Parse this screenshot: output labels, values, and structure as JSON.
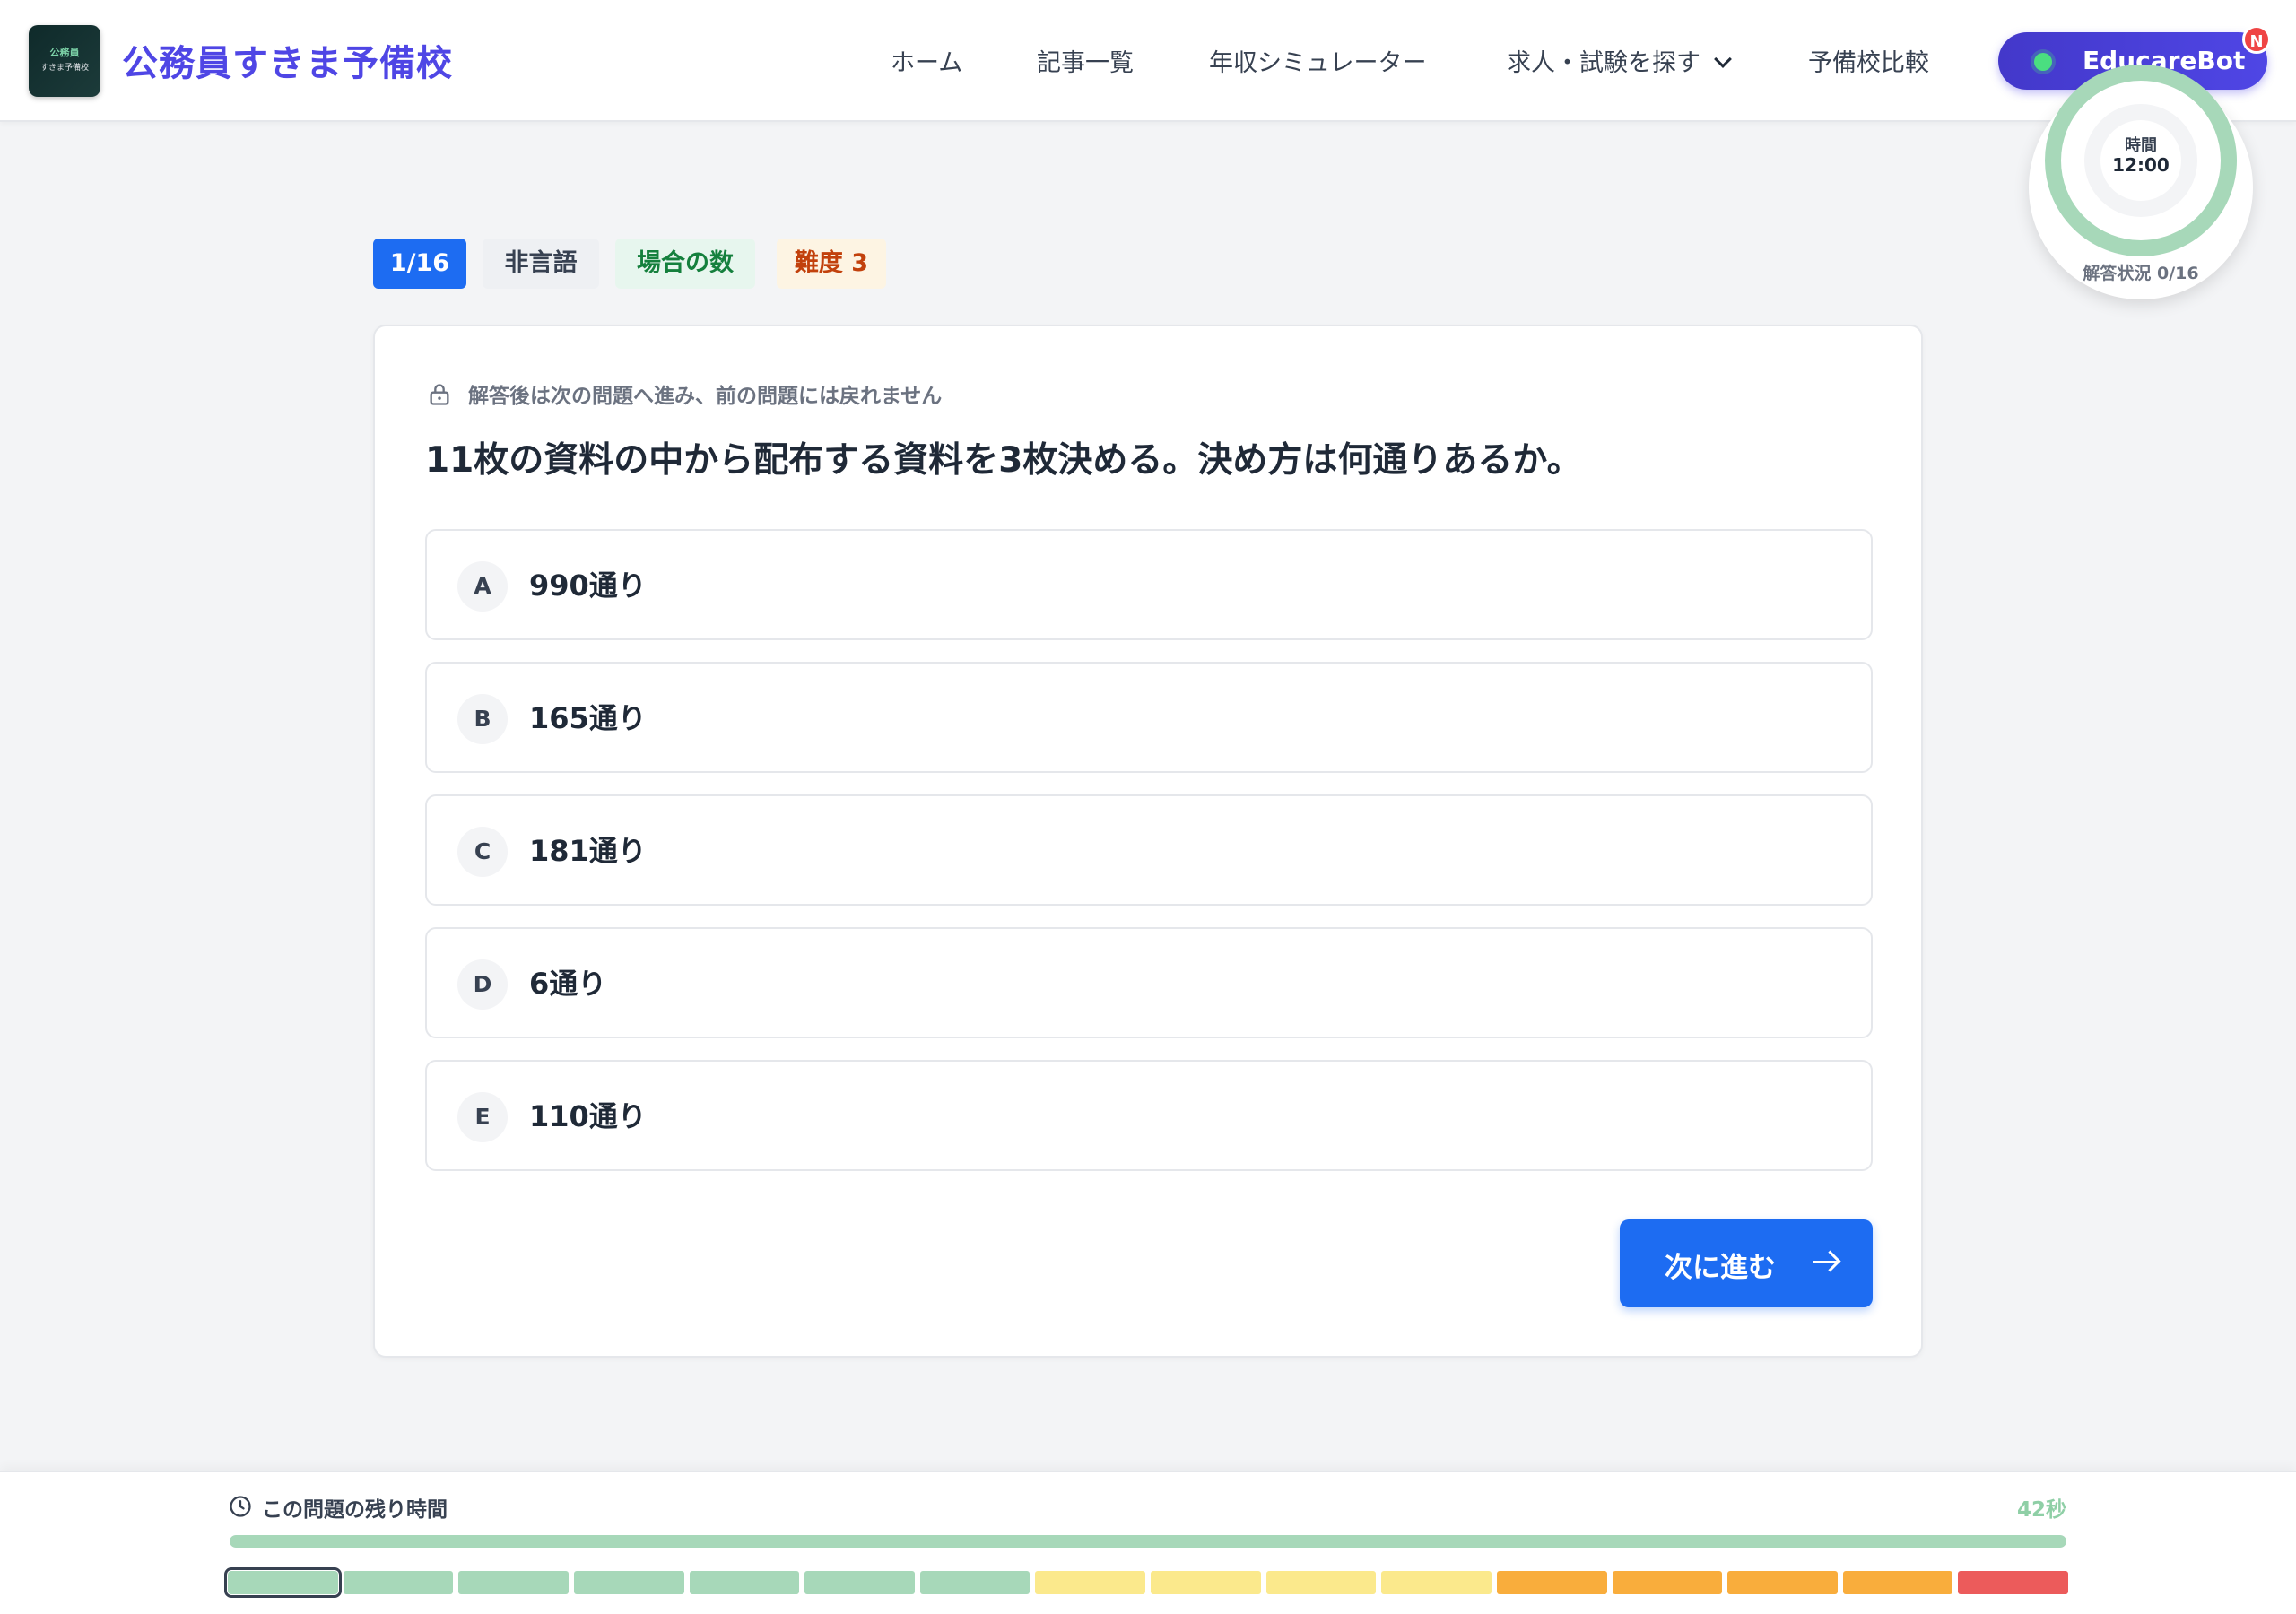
{
  "header": {
    "logo_line1": "公務員",
    "logo_line2": "すきま予備校",
    "brand": "公務員すきま予備校",
    "nav": [
      {
        "label": "ホーム"
      },
      {
        "label": "記事一覧"
      },
      {
        "label": "年収シミュレーター"
      },
      {
        "label": "求人・試験を探す"
      },
      {
        "label": "予備校比較"
      }
    ],
    "bot_label": "EducareBot",
    "bot_badge": "N"
  },
  "timer": {
    "label": "時間",
    "value": "12:00",
    "status": "解答状況 0/16"
  },
  "tags": {
    "count": "1/16",
    "category": "非言語",
    "subcategory": "場合の数",
    "difficulty": "難度 3"
  },
  "question": {
    "notice": "解答後は次の問題へ進み、前の問題には戻れません",
    "text": "11枚の資料の中から配布する資料を3枚決める。決め方は何通りあるか。",
    "options": [
      {
        "letter": "A",
        "text": "990通り"
      },
      {
        "letter": "B",
        "text": "165通り"
      },
      {
        "letter": "C",
        "text": "181通り"
      },
      {
        "letter": "D",
        "text": "6通り"
      },
      {
        "letter": "E",
        "text": "110通り"
      }
    ],
    "next_label": "次に進む"
  },
  "footer": {
    "remaining_label": "この問題の残り時間",
    "remaining_seconds": "42秒",
    "progress_fraction": 1.0,
    "segments": [
      {
        "color": "#a7d8b9",
        "current": true
      },
      {
        "color": "#a7d8b9"
      },
      {
        "color": "#a7d8b9"
      },
      {
        "color": "#a7d8b9"
      },
      {
        "color": "#a7d8b9"
      },
      {
        "color": "#a7d8b9"
      },
      {
        "color": "#a7d8b9"
      },
      {
        "color": "#fbe98c"
      },
      {
        "color": "#fbe98c"
      },
      {
        "color": "#fbe98c"
      },
      {
        "color": "#fbe98c"
      },
      {
        "color": "#f9ad3c"
      },
      {
        "color": "#f9ad3c"
      },
      {
        "color": "#f9ad3c"
      },
      {
        "color": "#f9ad3c"
      },
      {
        "color": "#ec5b5b"
      }
    ]
  },
  "colors": {
    "brand": "#4f46e5",
    "primary": "#1d6cf2",
    "timer_ring": "#a7d8b9"
  }
}
